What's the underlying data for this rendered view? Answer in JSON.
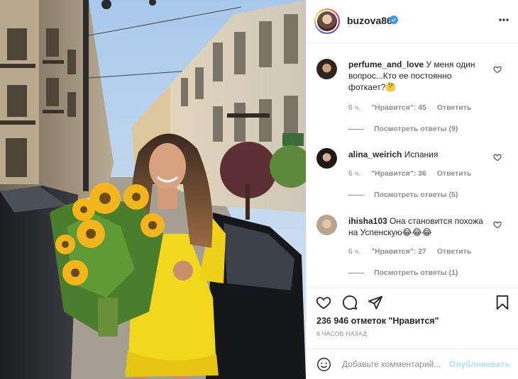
{
  "post": {
    "username": "buzova86",
    "verified": true,
    "likes_text": "236 946 отметок \"Нравится\"",
    "time_ago": "6 ЧАСОВ НАЗАД"
  },
  "comments": [
    {
      "username": "perfume_and_love",
      "text": "У меня один вопрос...Кто ее постоянно фоткает?🤔",
      "time": "6 ч.",
      "likes": "\"Нравится\": 45",
      "reply": "Ответить",
      "view_replies": "Посмотреть ответы (9)"
    },
    {
      "username": "alina_weirich",
      "text": "Испания",
      "time": "6 ч.",
      "likes": "\"Нравится\": 36",
      "reply": "Ответить",
      "view_replies": "Посмотреть ответы (5)"
    },
    {
      "username": "ihisha103",
      "text": "Она становится похожа на Успенскую😂😂😂",
      "time": "6 ч.",
      "likes": "\"Нравится\": 27",
      "reply": "Ответить",
      "view_replies": "Посмотреть ответы (1)"
    }
  ],
  "add_comment": {
    "placeholder": "Добавьте комментарий...",
    "publish_label": "Опубликовать"
  },
  "icons": {
    "header": [
      "verified-badge-icon",
      "more-options-icon"
    ],
    "actions": [
      "heart-icon",
      "comment-icon",
      "share-icon",
      "bookmark-icon"
    ],
    "comment": "heart-icon",
    "input": "emoji-icon"
  },
  "colors": {
    "accent_blue": "#3897f0",
    "publish_disabled": "#b2dffc",
    "secondary_text": "#8e8e8e",
    "primary_text": "#262626",
    "dress_yellow": "#f2d81c"
  }
}
